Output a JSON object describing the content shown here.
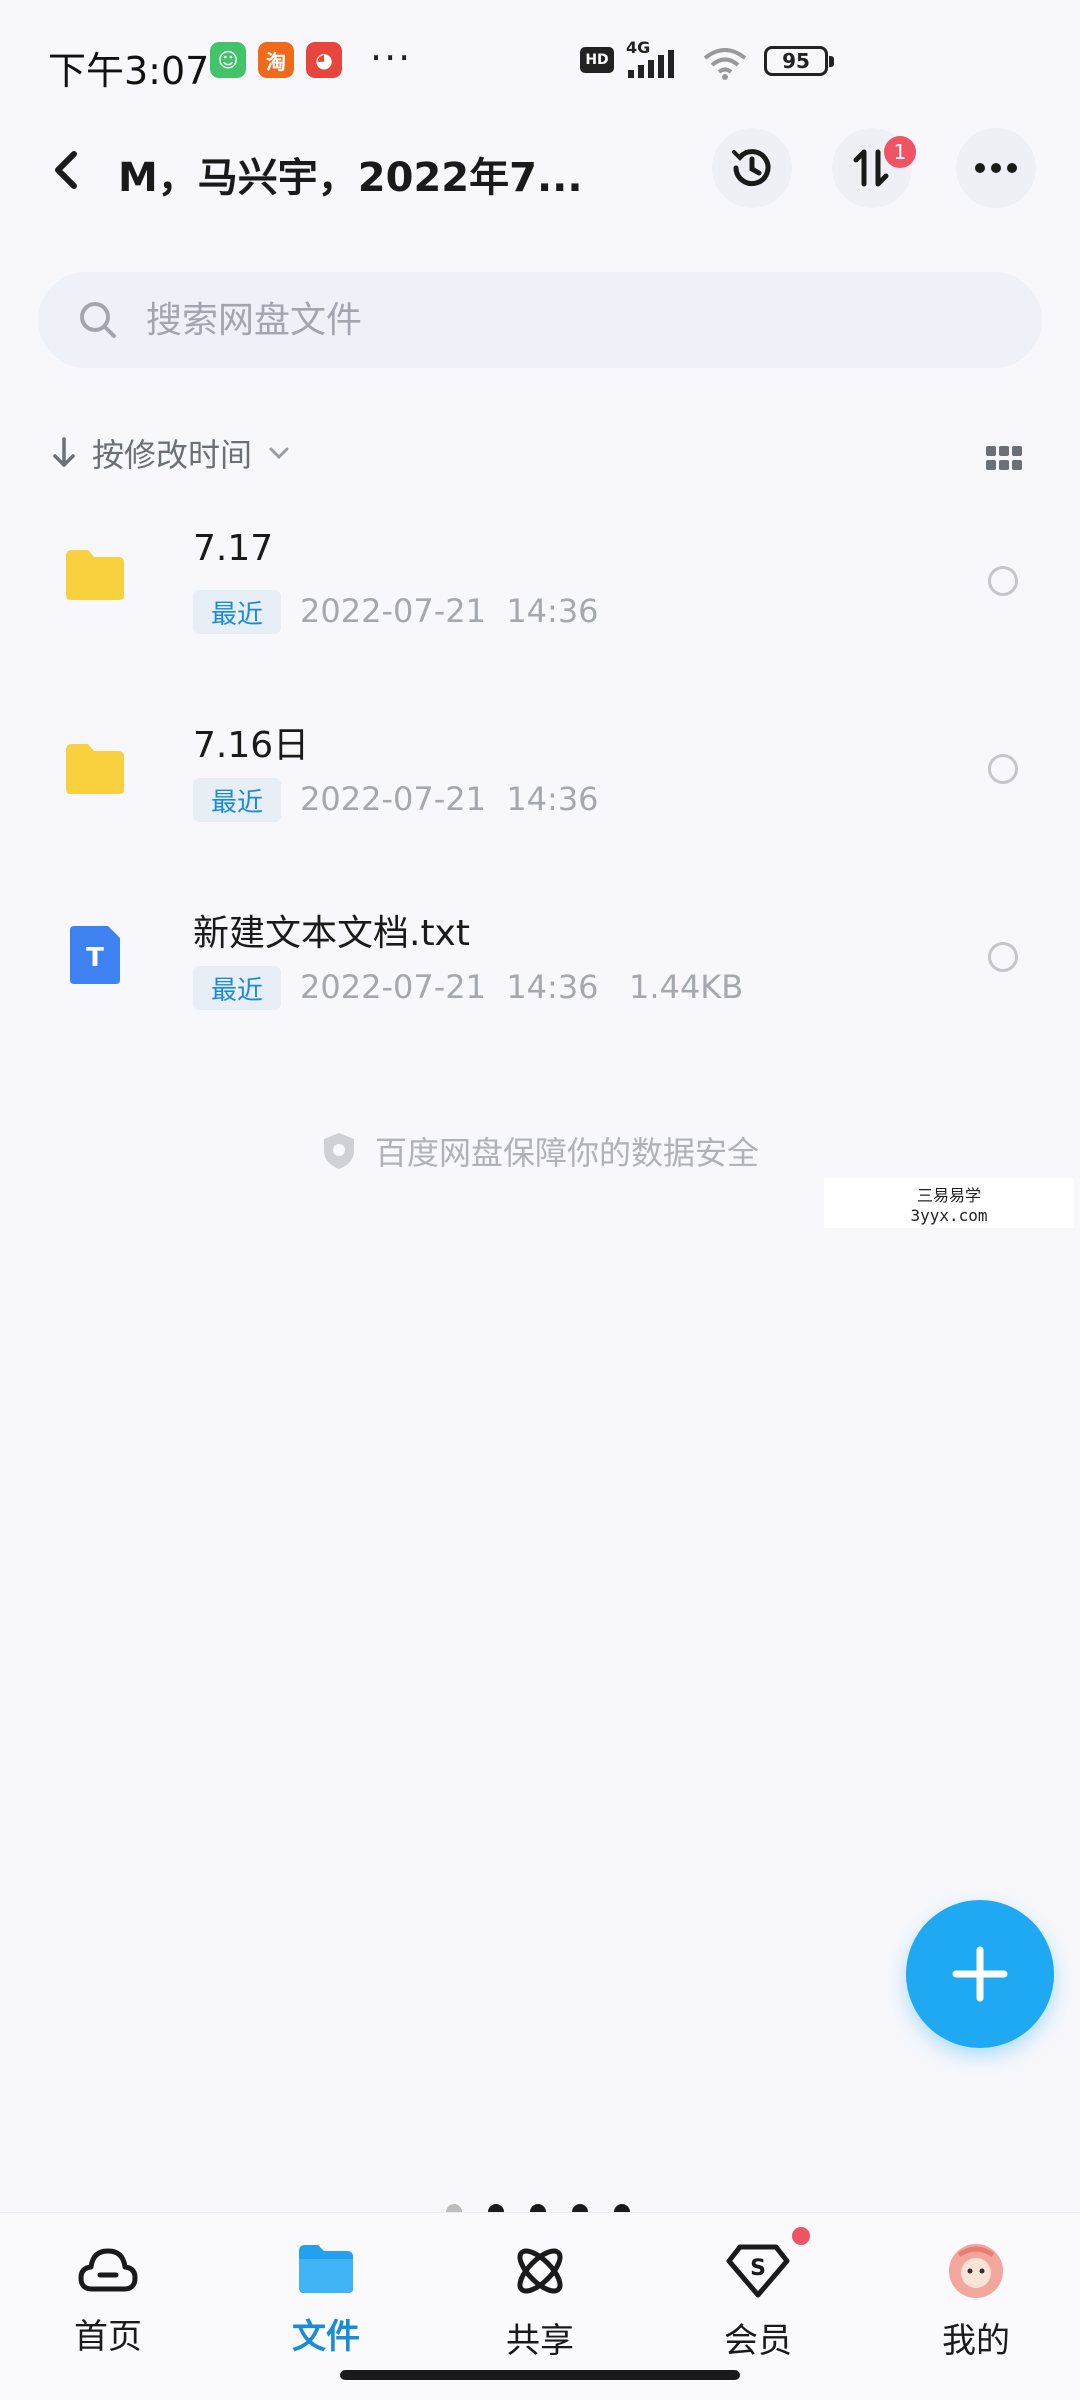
{
  "status_bar": {
    "time": "下午3:07",
    "apps": [
      {
        "icon": "chat-app-icon",
        "color": "#43c46a",
        "glyph": "☺"
      },
      {
        "icon": "taobao-app-icon",
        "color": "#f06a1c",
        "glyph": "淘"
      },
      {
        "icon": "mascot-app-icon",
        "color": "#e8453c",
        "glyph": "◕"
      }
    ],
    "more": "···",
    "hd": "HD",
    "network": "4G",
    "battery": "95"
  },
  "header": {
    "title": "M，马兴宇，2022年7...",
    "transfer_badge": "1"
  },
  "search": {
    "placeholder": "搜索网盘文件"
  },
  "sort": {
    "label": "按修改时间"
  },
  "files": [
    {
      "name": "7.17",
      "tag": "最近",
      "meta": "2022-07-21  14:36",
      "type": "folder"
    },
    {
      "name": "7.16日",
      "tag": "最近",
      "meta": "2022-07-21  14:36",
      "type": "folder"
    },
    {
      "name": "新建文本文档.txt",
      "tag": "最近",
      "meta": "2022-07-21  14:36   1.44KB",
      "type": "txt",
      "type_letter": "T"
    }
  ],
  "safety_note": "百度网盘保障你的数据安全",
  "watermark": {
    "line1": "三易易学",
    "line2": "3yyx.com"
  },
  "nav": {
    "items": [
      {
        "label": "首页",
        "icon": "cloud-home-icon"
      },
      {
        "label": "文件",
        "icon": "folder-files-icon",
        "active": true
      },
      {
        "label": "共享",
        "icon": "share-atom-icon"
      },
      {
        "label": "会员",
        "icon": "vip-diamond-icon"
      },
      {
        "label": "我的",
        "icon": "avatar-icon"
      }
    ]
  },
  "colors": {
    "accent": "#1a8bd6",
    "fab": "#1fa9f2",
    "folder": "#f9d13e",
    "txt": "#3d82f0",
    "badge": "#f05364"
  }
}
